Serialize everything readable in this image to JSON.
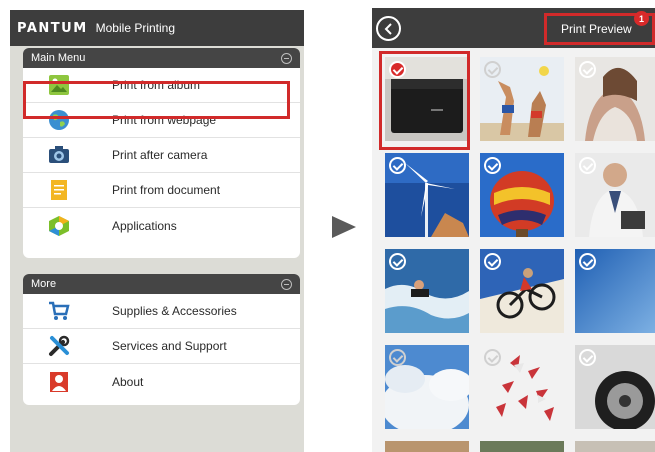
{
  "left_app": {
    "brand": "PANTUM",
    "title": "Mobile Printing",
    "main_menu": {
      "header": "Main Menu",
      "items": [
        {
          "label": "Print from album",
          "icon": "album-icon"
        },
        {
          "label": "Print from webpage",
          "icon": "globe-icon"
        },
        {
          "label": "Print after camera",
          "icon": "camera-icon"
        },
        {
          "label": "Print from document",
          "icon": "document-icon"
        },
        {
          "label": "Applications",
          "icon": "applications-icon"
        }
      ]
    },
    "more_menu": {
      "header": "More",
      "items": [
        {
          "label": "Supplies & Accessories",
          "icon": "cart-icon"
        },
        {
          "label": "Services and Support",
          "icon": "tools-icon"
        },
        {
          "label": "About",
          "icon": "person-icon"
        }
      ]
    }
  },
  "right_app": {
    "print_preview_label": "Print Preview",
    "selected_count": "1",
    "photos": [
      {
        "name": "printer",
        "checked": true
      },
      {
        "name": "beach-volleyball",
        "checked": false
      },
      {
        "name": "woman-portrait",
        "checked": false
      },
      {
        "name": "wind-turbine",
        "checked": false
      },
      {
        "name": "hot-air-balloon",
        "checked": false
      },
      {
        "name": "business-man",
        "checked": false
      },
      {
        "name": "jet-ski",
        "checked": false
      },
      {
        "name": "cyclist",
        "checked": false
      },
      {
        "name": "blue-sky",
        "checked": false
      },
      {
        "name": "clouds",
        "checked": false
      },
      {
        "name": "pinwheels",
        "checked": false
      },
      {
        "name": "car-wheel",
        "checked": false
      }
    ]
  },
  "colors": {
    "accent_red": "#d12a2a",
    "header_dark": "#3d3d3d"
  }
}
